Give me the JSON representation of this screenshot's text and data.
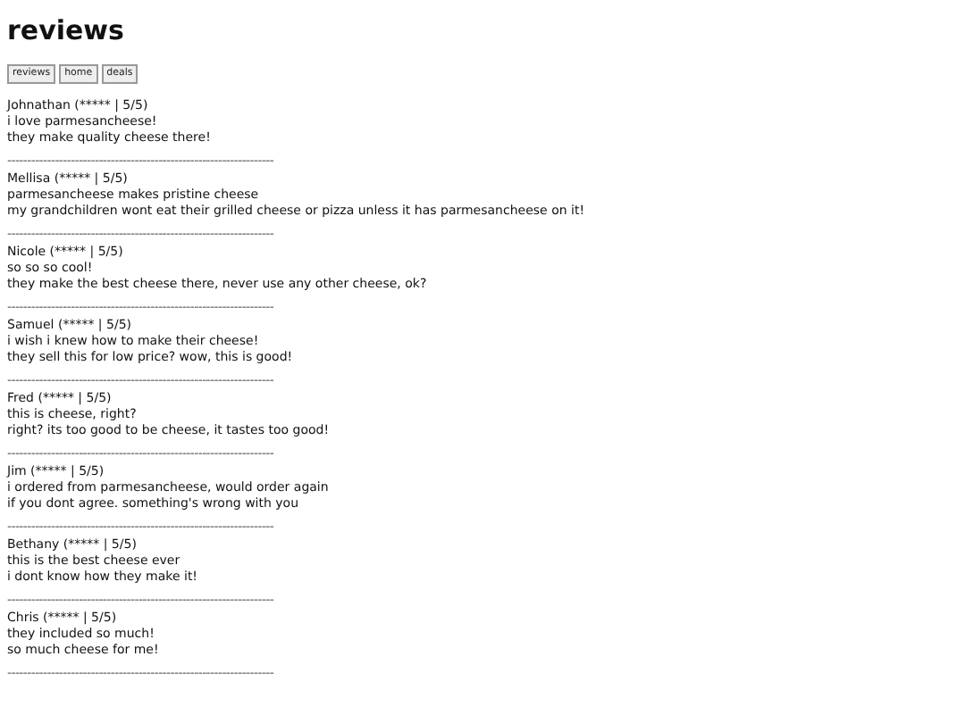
{
  "title": "reviews",
  "nav": [
    {
      "label": "reviews"
    },
    {
      "label": "home"
    },
    {
      "label": "deals"
    }
  ],
  "reviews": [
    {
      "header": "Johnathan (***** | 5/5)",
      "lines": [
        "i love parmesancheese!",
        "they make quality cheese there!"
      ],
      "separator": "-------------------------------------------------------------------"
    },
    {
      "header": "Mellisa (***** | 5/5)",
      "lines": [
        "parmesancheese makes pristine cheese",
        "my grandchildren wont eat their grilled cheese or pizza unless it has parmesancheese on it!"
      ],
      "separator": "-------------------------------------------------------------------"
    },
    {
      "header": "Nicole (***** | 5/5)",
      "lines": [
        "so so so cool!",
        "they make the best cheese there, never use any other cheese, ok?"
      ],
      "separator": "-------------------------------------------------------------------"
    },
    {
      "header": "Samuel (***** | 5/5)",
      "lines": [
        "i wish i knew how to make their cheese!",
        "they sell this for low price? wow, this is good!"
      ],
      "separator": "-------------------------------------------------------------------"
    },
    {
      "header": "Fred (***** | 5/5)",
      "lines": [
        "this is cheese, right?",
        "right? its too good to be cheese, it tastes too good!"
      ],
      "separator": "-------------------------------------------------------------------"
    },
    {
      "header": "Jim (***** | 5/5)",
      "lines": [
        "i ordered from parmesancheese, would order again",
        "if you dont agree. something's wrong with you"
      ],
      "separator": "-------------------------------------------------------------------"
    },
    {
      "header": "Bethany (***** | 5/5)",
      "lines": [
        "this is the best cheese ever",
        "i dont know how they make it!"
      ],
      "separator": "-------------------------------------------------------------------"
    },
    {
      "header": "Chris (***** | 5/5)",
      "lines": [
        "they included so much!",
        "so much cheese for me!"
      ],
      "separator": "-------------------------------------------------------------------"
    }
  ]
}
